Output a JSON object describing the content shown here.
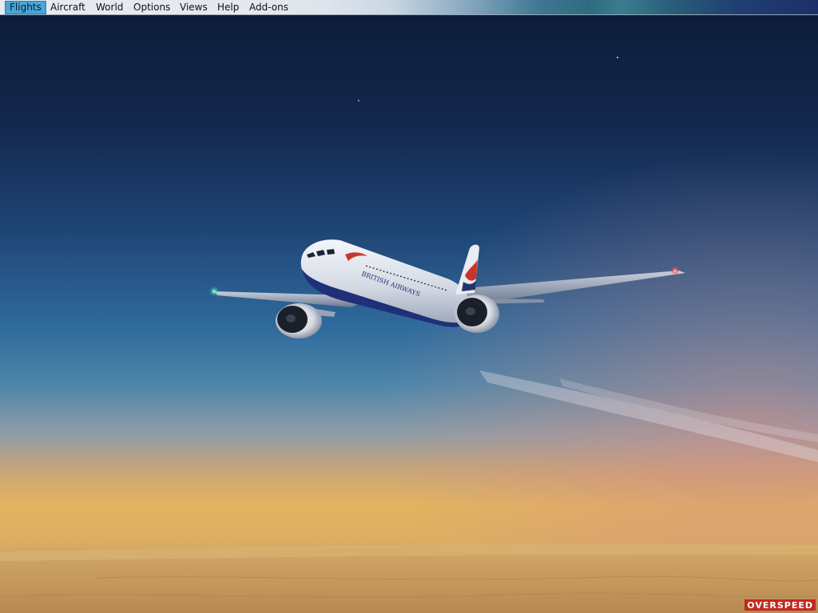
{
  "menu": {
    "items": [
      {
        "label": "Flights",
        "active": true
      },
      {
        "label": "Aircraft",
        "active": false
      },
      {
        "label": "World",
        "active": false
      },
      {
        "label": "Options",
        "active": false
      },
      {
        "label": "Views",
        "active": false
      },
      {
        "label": "Help",
        "active": false
      },
      {
        "label": "Add-ons",
        "active": false
      }
    ]
  },
  "scene": {
    "sky_colors": {
      "top": "#0e1d3b",
      "mid": "#2f6596",
      "horizon_gold": "#e1b45c",
      "ground": "#c59a5c"
    },
    "aircraft": {
      "livery_text": "BRITISH AIRWAYS",
      "colors": {
        "fuselage": "#e4e8ee",
        "belly": "#1f2f78",
        "tail_red": "#c8362b",
        "tail_blue": "#24336e"
      }
    },
    "nav_lights": {
      "left": "#4fe0c0",
      "right": "#ff4a55"
    }
  },
  "status": {
    "overspeed_label": "OVERSPEED",
    "overspeed_color": "#c22a1f"
  }
}
